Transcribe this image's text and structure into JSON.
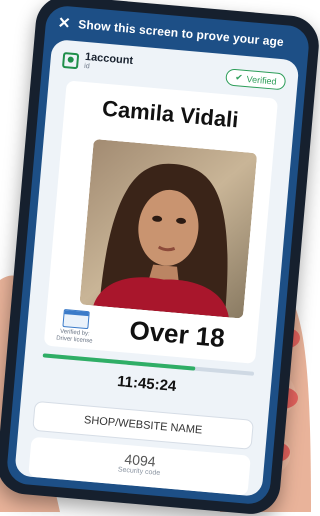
{
  "banner": {
    "text": "Show this screen to prove your age"
  },
  "brand": {
    "name": "1account",
    "sub": "id"
  },
  "status": {
    "label": "Verified"
  },
  "person": {
    "name": "Camila Vidali"
  },
  "verification": {
    "method": "Verified by: Driver license"
  },
  "age_claim": "Over 18",
  "clock": "11:45:24",
  "timer_progress": 0.72,
  "shop": {
    "label": "SHOP/WEBSITE NAME"
  },
  "security": {
    "code": "4094",
    "label": "Security code"
  },
  "colors": {
    "screen": "#1d4f86",
    "verified": "#2c9d58",
    "progress": "#2fae66"
  }
}
